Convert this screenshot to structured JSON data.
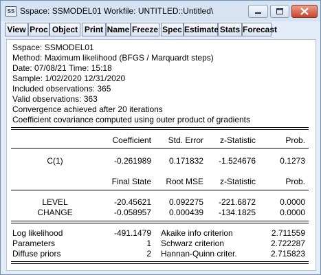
{
  "window": {
    "icon_text": "SS",
    "title": "Sspace: SSMODEL01   Workfile: UNTITLED::Untitled\\"
  },
  "toolbar": [
    "View",
    "Proc",
    "Object",
    "Print",
    "Name",
    "Freeze",
    "Spec",
    "Estimate",
    "Stats",
    "Forecast"
  ],
  "header_lines": [
    "Sspace: SSMODEL01",
    "Method: Maximum likelihood  (BFGS / Marquardt steps)",
    "Date: 07/08/21   Time: 15:18",
    "Sample: 1/02/2020 12/31/2020",
    "Included observations: 365",
    "Valid observations: 363",
    "Convergence achieved after 20 iterations",
    "Coefficient covariance computed using outer product of gradients"
  ],
  "coef_table": {
    "headers": [
      "Coefficient",
      "Std. Error",
      "z-Statistic",
      "Prob."
    ],
    "rows": [
      {
        "name": "C(1)",
        "values": [
          "-0.261989",
          "0.171832",
          "-1.524676",
          "0.1273"
        ]
      }
    ]
  },
  "state_table": {
    "headers": [
      "Final State",
      "Root MSE",
      "z-Statistic",
      "Prob."
    ],
    "rows": [
      {
        "name": "LEVEL",
        "values": [
          "-20.45621",
          "0.092275",
          "-221.6872",
          "0.0000"
        ]
      },
      {
        "name": "CHANGE",
        "values": [
          "-0.058957",
          "0.000439",
          "-134.1825",
          "0.0000"
        ]
      }
    ]
  },
  "stats": [
    {
      "label": "Log likelihood",
      "value": "-491.1479",
      "label2": "Akaike info criterion",
      "value2": "2.711559"
    },
    {
      "label": "Parameters",
      "value": "1",
      "label2": "Schwarz criterion",
      "value2": "2.722287"
    },
    {
      "label": "Diffuse priors",
      "value": "2",
      "label2": "Hannan-Quinn criter.",
      "value2": "2.715823"
    }
  ]
}
